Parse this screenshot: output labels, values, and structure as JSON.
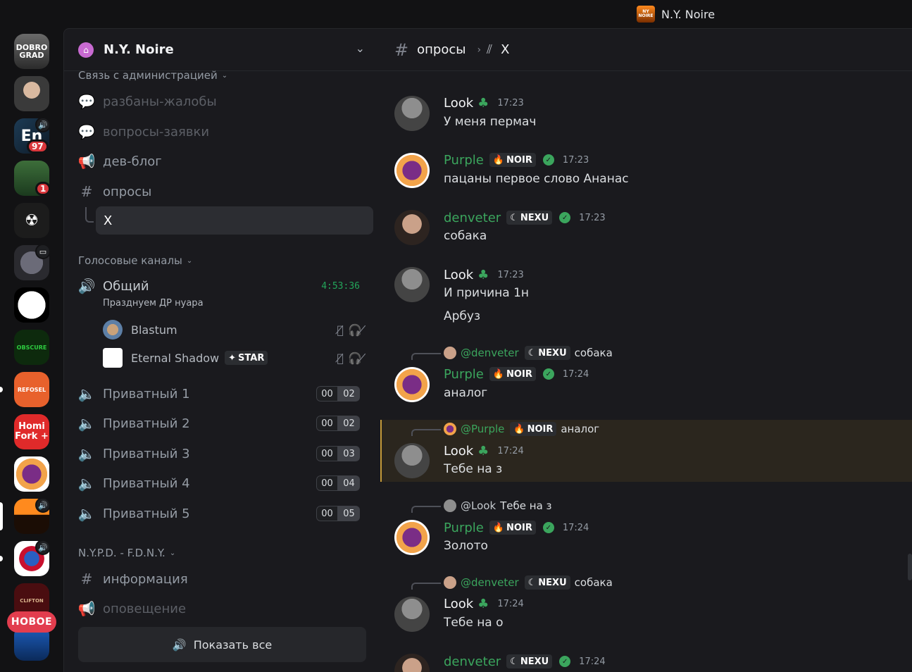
{
  "window": {
    "title": "N.Y. Noire"
  },
  "rail": {
    "servers": [
      {
        "name": "dobrograd",
        "label": "DOBRO GRAD"
      },
      {
        "name": "face-server",
        "label": ""
      },
      {
        "name": "en-server",
        "label": "En",
        "badge": "97"
      },
      {
        "name": "torii-server",
        "label": "",
        "badge": "1"
      },
      {
        "name": "mask-server",
        "label": ""
      },
      {
        "name": "anime-server",
        "label": ""
      },
      {
        "name": "silhouette-server",
        "label": ""
      },
      {
        "name": "obscure-server",
        "label": "OBSCURE"
      },
      {
        "name": "refosel-server",
        "label": "REFOSEL"
      },
      {
        "name": "homi-server",
        "label": "Homi Fork +"
      },
      {
        "name": "purple-hat-server",
        "label": ""
      },
      {
        "name": "ny-noire-server",
        "label": ""
      },
      {
        "name": "fdny-server",
        "label": ""
      },
      {
        "name": "clifton-server",
        "label": "CLIFTON"
      },
      {
        "name": "blue-server",
        "label": ""
      }
    ],
    "new_badge": "НОВОЕ"
  },
  "sidebar": {
    "guild_name": "N.Y. Noire",
    "cat_admin": "Связь с администрацией",
    "ch_unbans": "разбаны-жалобы",
    "ch_requests": "вопросы-заявки",
    "ch_devblog": "дев-блог",
    "ch_polls": "опросы",
    "thread_x": "X",
    "cat_voice": "Голосовые каналы",
    "vc_general": "Общий",
    "vc_general_time": "4:53:36",
    "vc_general_status": "Празднуем ДР нуара",
    "vc_users": [
      {
        "name": "Blastum",
        "tag": ""
      },
      {
        "name": "Eternal Shadow",
        "tag": "STAR"
      }
    ],
    "private_channels": [
      {
        "name": "Приватный 1",
        "a": "00",
        "b": "02"
      },
      {
        "name": "Приватный 2",
        "a": "00",
        "b": "02"
      },
      {
        "name": "Приватный 3",
        "a": "00",
        "b": "03"
      },
      {
        "name": "Приватный 4",
        "a": "00",
        "b": "04"
      },
      {
        "name": "Приватный 5",
        "a": "00",
        "b": "05"
      }
    ],
    "cat_nypd": "N.Y.P.D. - F.D.N.Y.",
    "ch_info": "информация",
    "ch_alerts": "оповещение",
    "show_all": "Показать все"
  },
  "chat": {
    "channel": "опросы",
    "thread": "X",
    "messages": [
      {
        "user": "Look",
        "time": "17:23",
        "lines": [
          "У меня пермач"
        ]
      },
      {
        "user": "Purple",
        "tag": "NOIR",
        "time": "17:23",
        "lines": [
          "пацаны первое слово Ананас"
        ]
      },
      {
        "user": "denveter",
        "tag": "NEXU",
        "time": "17:23",
        "lines": [
          "собака"
        ]
      },
      {
        "user": "Look",
        "time": "17:23",
        "lines": [
          "И причина 1н",
          "Арбуз"
        ]
      },
      {
        "user": "Purple",
        "tag": "NOIR",
        "time": "17:24",
        "lines": [
          "аналог"
        ],
        "reply": {
          "name": "@denveter",
          "tag": "NEXU",
          "text": "собака"
        }
      },
      {
        "user": "Look",
        "time": "17:24",
        "lines": [
          "Тебе на з"
        ],
        "reply": {
          "name": "@Purple",
          "tag": "NOIR",
          "text": "аналог"
        }
      },
      {
        "user": "Purple",
        "tag": "NOIR",
        "time": "17:24",
        "lines": [
          "Золото"
        ],
        "reply": {
          "name": "@Look",
          "text": "Тебе на з"
        }
      },
      {
        "user": "Look",
        "time": "17:24",
        "lines": [
          "Тебе на о"
        ],
        "reply": {
          "name": "@denveter",
          "tag": "NEXU",
          "text": "собака"
        }
      },
      {
        "user": "denveter",
        "tag": "NEXU",
        "time": "17:24",
        "lines": []
      }
    ]
  },
  "colors": {
    "accent_green": "#3ba55d",
    "highlight": "#c49a3a",
    "badge_red": "#da373c"
  }
}
